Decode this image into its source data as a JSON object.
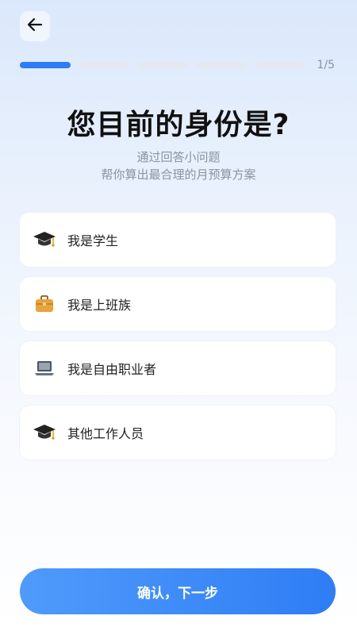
{
  "header": {
    "back_icon": "arrow-left-icon",
    "progress": {
      "current": 1,
      "total": 5,
      "text": "1/5"
    }
  },
  "question": {
    "title": "您目前的身份是?",
    "subtitle_line1": "通过回答小问题",
    "subtitle_line2": "帮你算出最合理的月预算方案"
  },
  "options": [
    {
      "icon": "graduation-cap-icon",
      "label": "我是学生"
    },
    {
      "icon": "briefcase-icon",
      "label": "我是上班族"
    },
    {
      "icon": "laptop-icon",
      "label": "我是自由职业者"
    },
    {
      "icon": "graduation-cap-icon",
      "label": "其他工作人员"
    }
  ],
  "footer": {
    "confirm_label": "确认，下一步"
  },
  "colors": {
    "accent": "#2c7df6",
    "progress_track": "#e4e9f1"
  }
}
